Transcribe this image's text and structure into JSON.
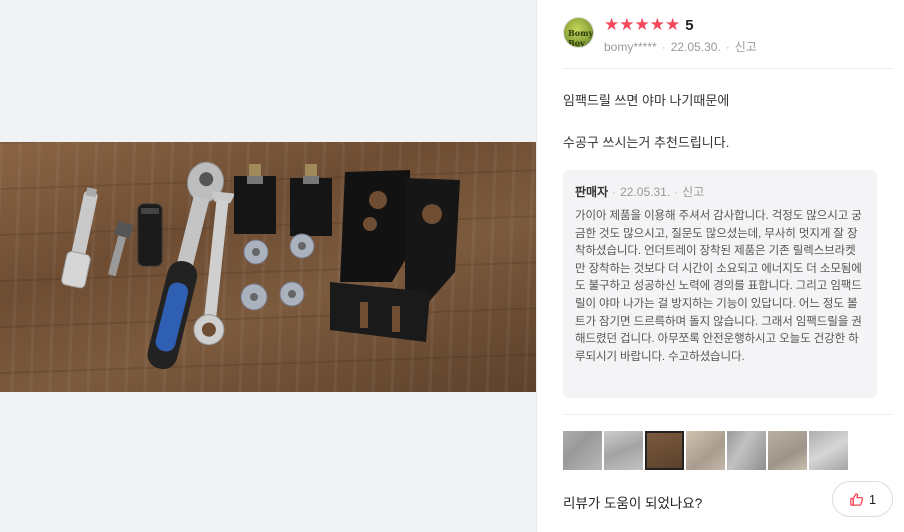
{
  "review": {
    "rating": "★★★★★",
    "score": "5",
    "author": "bomy*****",
    "date": "22.05.30.",
    "report": "신고",
    "avatar_text": "Bomy Boy",
    "text_line1": "임팩드릴 쓰면 야마 나기때문에",
    "text_line2": "수공구 쓰시는거 추천드립니다."
  },
  "seller_reply": {
    "label": "판매자",
    "date": "22.05.31.",
    "report": "신고",
    "body": "가이아 제품을 이용해 주셔서 감사합니다. 걱정도 많으시고 궁금한 것도 많으시고, 질문도 많으셨는데, 무사히 멋지게 잘 장착하셨습니다.  언더트레이 장착된 제품은 기존 릴렉스브라켓만 장착하는 것보다 더 시간이 소요되고 에너지도 더 소모됨에도 불구하고 성공하신 노력에 경의를 표합니다. 그리고 임팩드릴이 야마 나가는 걸 방지하는 기능이 있답니다. 어느 정도 볼트가 잠기면 드르륵하며 돌지 않습니다. 그래서 임팩드릴을 권해드렸던 겁니다. 아무쪼록 안전운행하시고 오늘도 건강한 하루되시기 바랍니다. 수고하셨습니다."
  },
  "thumbnails": {
    "count": 7,
    "active_index": 2
  },
  "footer": {
    "helpful_question": "리뷰가 도움이 되었나요?",
    "like_count": "1"
  },
  "colors": {
    "star": "#f5485c",
    "seller_bg": "#f4f4f6",
    "photo_bg": "#f0f2f5"
  }
}
